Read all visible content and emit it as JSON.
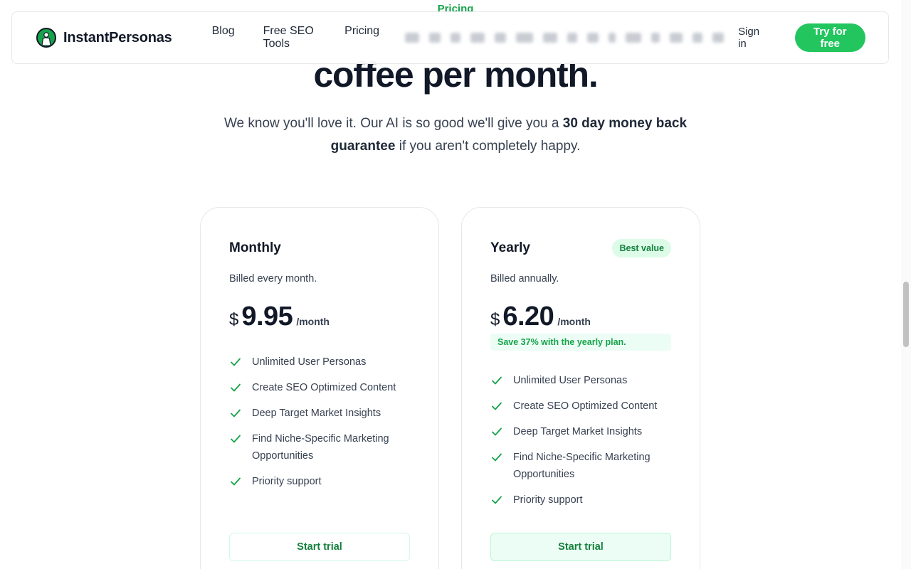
{
  "eyebrow": "Pricing",
  "nav": {
    "brand": "InstantPersonas",
    "links": [
      "Blog",
      "Free SEO Tools",
      "Pricing"
    ],
    "sign_in": "Sign in",
    "cta": "Try for free"
  },
  "hero": {
    "headline": "coffee per month.",
    "sub_before": "We know you'll love it. Our AI is so good we'll give you a ",
    "sub_bold": "30 day money back guarantee",
    "sub_after": " if you aren't completely happy."
  },
  "plans": [
    {
      "name": "Monthly",
      "billed": "Billed every month.",
      "currency": "$",
      "price": "9.95",
      "period": "/month",
      "features": [
        "Unlimited User Personas",
        "Create SEO Optimized Content",
        "Deep Target Market Insights",
        "Find Niche-Specific Marketing Opportunities",
        "Priority support"
      ],
      "cta": "Start trial"
    },
    {
      "name": "Yearly",
      "badge": "Best value",
      "billed": "Billed annually.",
      "currency": "$",
      "price": "6.20",
      "period": "/month",
      "savings": "Save 37% with the yearly plan.",
      "features": [
        "Unlimited User Personas",
        "Create SEO Optimized Content",
        "Deep Target Market Insights",
        "Find Niche-Specific Marketing Opportunities",
        "Priority support"
      ],
      "cta": "Start trial"
    }
  ],
  "colors": {
    "accent": "#22c55e",
    "accent_dark": "#15803d",
    "accent_light": "#dcfce7",
    "text": "#111827"
  }
}
